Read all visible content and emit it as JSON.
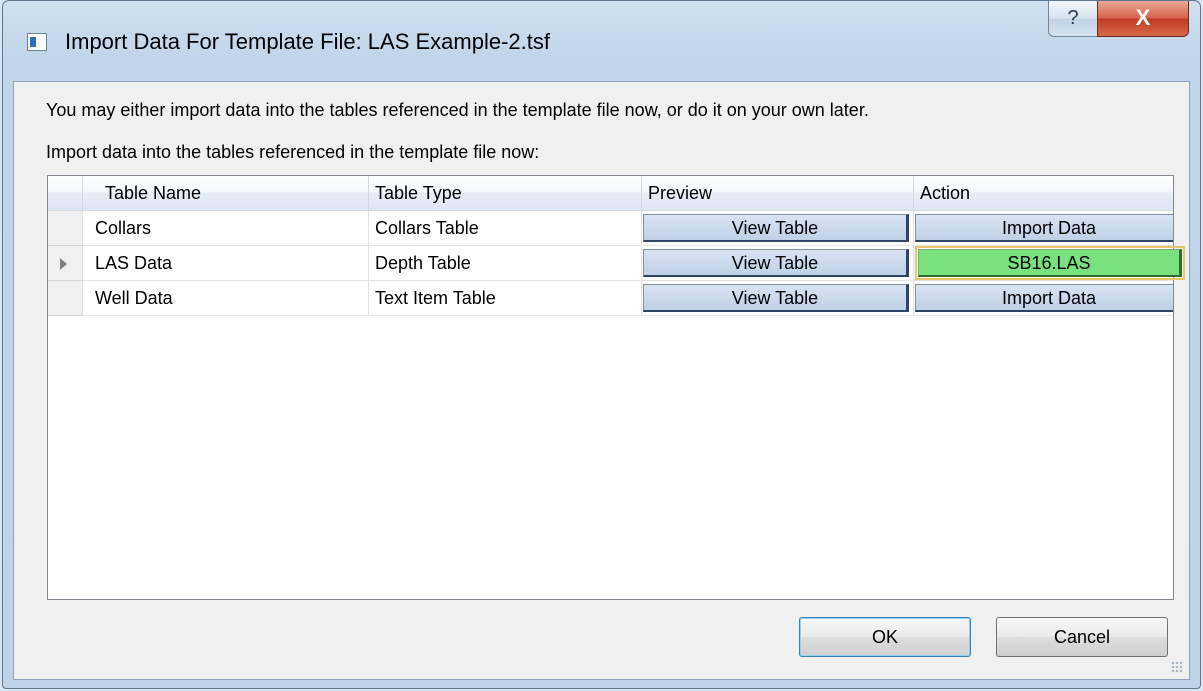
{
  "window": {
    "title": "Import Data For Template File: LAS Example-2.tsf",
    "help_label": "?",
    "close_label": "X"
  },
  "instructions": {
    "line1": "You may either import data into the tables referenced in the template file now, or do it on your own later.",
    "line2": "Import data into the tables referenced in the template file now:"
  },
  "grid": {
    "columns": [
      "Table Name",
      "Table Type",
      "Preview",
      "Action"
    ],
    "rows": [
      {
        "name": "Collars",
        "type": "Collars Table",
        "preview": "View Table",
        "action": "Import Data",
        "current": false
      },
      {
        "name": "LAS Data",
        "type": "Depth Table",
        "preview": "View Table",
        "action": "SB16.LAS",
        "current": true
      },
      {
        "name": "Well Data",
        "type": "Text Item Table",
        "preview": "View Table",
        "action": "Import Data",
        "current": false
      }
    ]
  },
  "buttons": {
    "ok": "OK",
    "cancel": "Cancel"
  },
  "colors": {
    "loaded_action": "#79e27f",
    "focus_outline": "#e9c46a"
  }
}
